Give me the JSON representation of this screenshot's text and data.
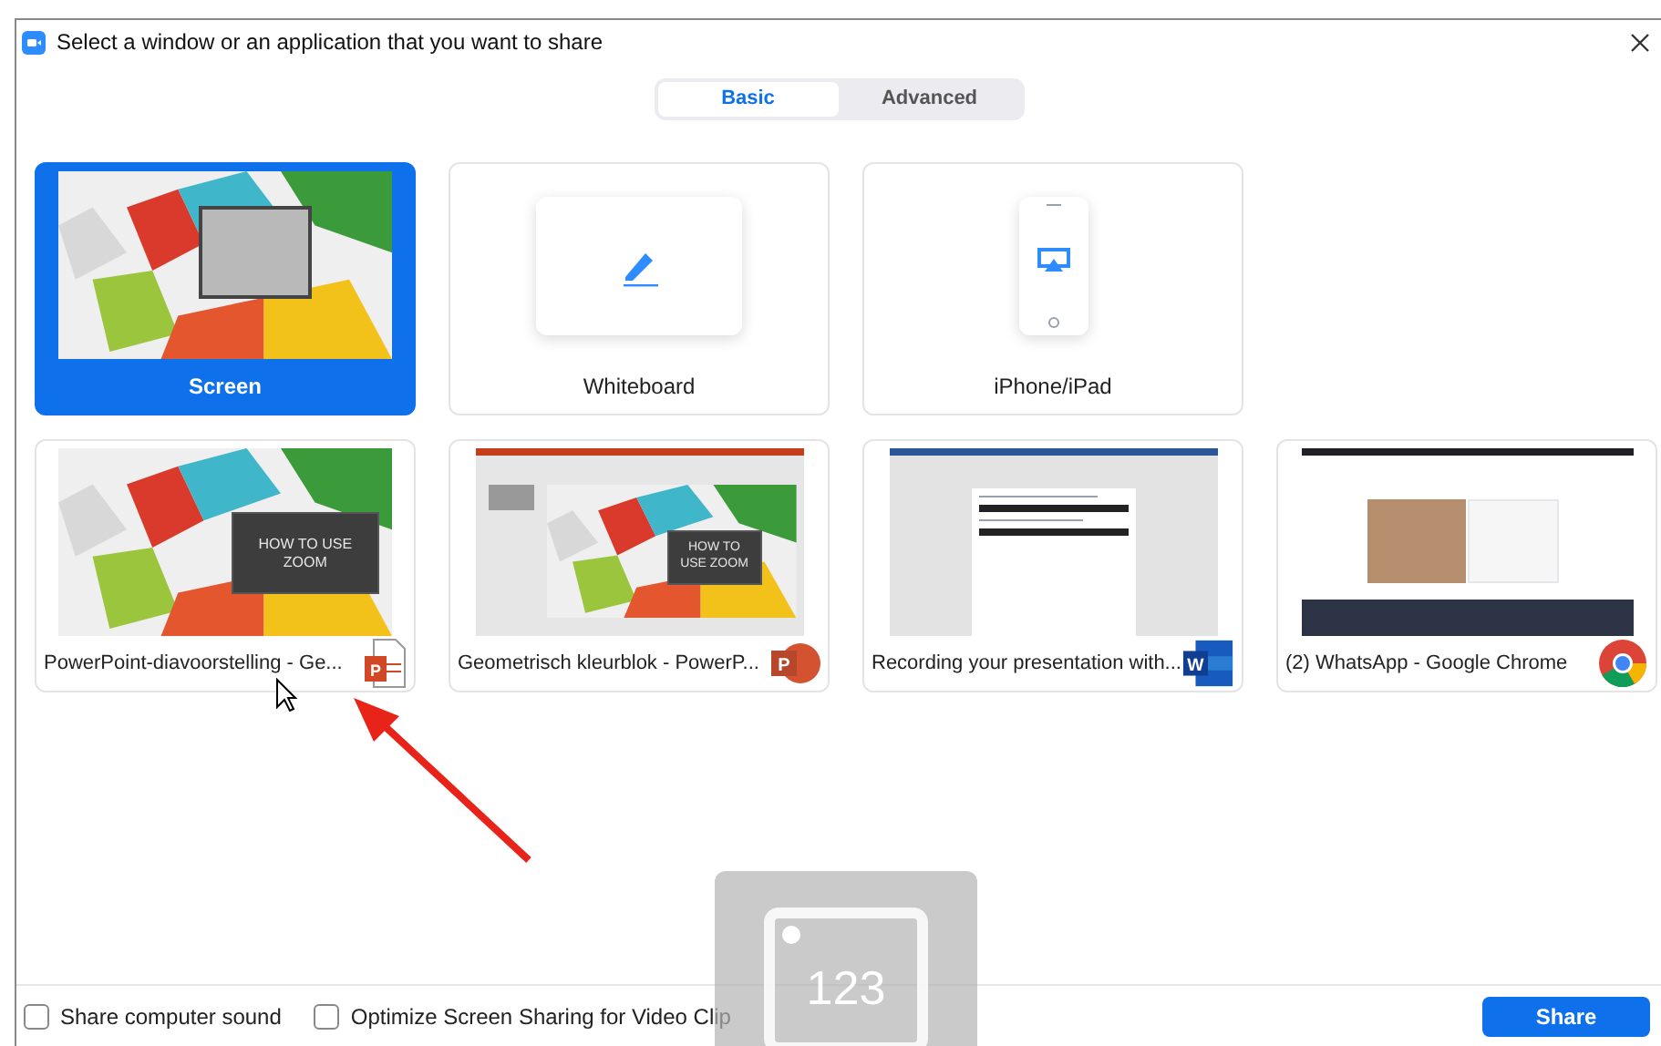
{
  "window": {
    "title": "Select a window or an application that you want to share"
  },
  "tabs": [
    {
      "label": "Basic",
      "selected": true
    },
    {
      "label": "Advanced",
      "selected": false
    }
  ],
  "sources": [
    {
      "kind": "screen",
      "label": "Screen",
      "selected": true
    },
    {
      "kind": "whiteboard",
      "label": "Whiteboard",
      "selected": false
    },
    {
      "kind": "device",
      "label": "iPhone/iPad",
      "selected": false
    },
    {
      "kind": "slideshow",
      "label": "PowerPoint-diavoorstelling  -  Ge...",
      "slide_title": "HOW TO USE ZOOM",
      "app_icon": {
        "kind": "powerpoint-show",
        "letter": "P"
      },
      "selected": false
    },
    {
      "kind": "powerpoint",
      "label": "Geometrisch kleurblok - PowerP...",
      "slide_title": "HOW TO USE ZOOM",
      "app_icon": {
        "kind": "powerpoint",
        "letter": "P"
      },
      "selected": false
    },
    {
      "kind": "document",
      "label": "Recording your presentation with...",
      "app_icon": {
        "kind": "word",
        "letter": "W"
      },
      "selected": false
    },
    {
      "kind": "browser",
      "label": "(2) WhatsApp - Google Chrome",
      "app_icon": {
        "kind": "chrome"
      },
      "selected": false
    }
  ],
  "drag_preview": {
    "text": "123"
  },
  "options": [
    {
      "label": "Share computer sound",
      "checked": false
    },
    {
      "label": "Optimize Screen Sharing for Video Clip",
      "checked": false
    }
  ],
  "share_button": "Share"
}
